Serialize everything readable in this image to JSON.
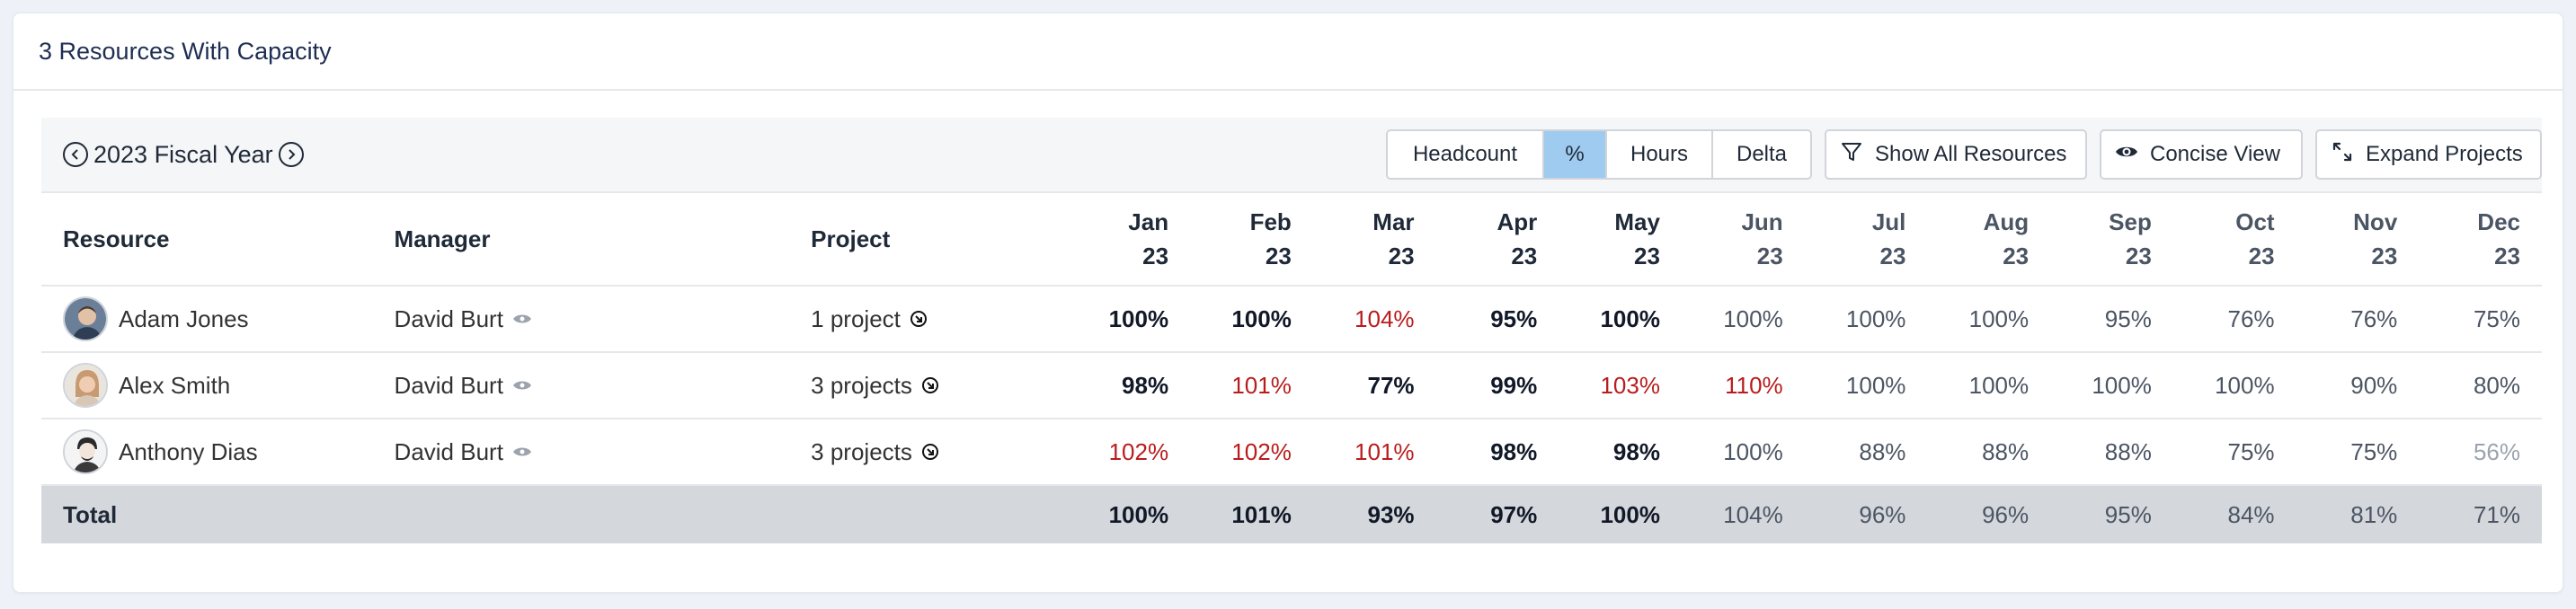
{
  "card": {
    "title": "3 Resources With Capacity"
  },
  "toolbar": {
    "fiscal_year": "2023 Fiscal Year",
    "prev_icon": "chevron-left-circle-icon",
    "next_icon": "chevron-right-circle-icon",
    "view_modes": [
      {
        "label": "Headcount",
        "selected": false
      },
      {
        "label": "%",
        "selected": true
      },
      {
        "label": "Hours",
        "selected": false
      },
      {
        "label": "Delta",
        "selected": false
      }
    ],
    "filter_label": "Show All Resources",
    "view_label": "Concise View",
    "expand_label": "Expand Projects",
    "selected_color": "#9fcbf0"
  },
  "table": {
    "headers": {
      "resource": "Resource",
      "manager": "Manager",
      "project": "Project"
    },
    "months": [
      {
        "m": "Jan",
        "y": "23"
      },
      {
        "m": "Feb",
        "y": "23"
      },
      {
        "m": "Mar",
        "y": "23"
      },
      {
        "m": "Apr",
        "y": "23"
      },
      {
        "m": "May",
        "y": "23"
      },
      {
        "m": "Jun",
        "y": "23"
      },
      {
        "m": "Jul",
        "y": "23"
      },
      {
        "m": "Aug",
        "y": "23"
      },
      {
        "m": "Sep",
        "y": "23"
      },
      {
        "m": "Oct",
        "y": "23"
      },
      {
        "m": "Nov",
        "y": "23"
      },
      {
        "m": "Dec",
        "y": "23"
      }
    ],
    "rows": [
      {
        "name": "Adam Jones",
        "manager": "David Burt",
        "project": "1 project",
        "values": [
          "100%",
          "100%",
          "104%",
          "95%",
          "100%",
          "100%",
          "100%",
          "100%",
          "95%",
          "76%",
          "76%",
          "75%"
        ]
      },
      {
        "name": "Alex Smith",
        "manager": "David Burt",
        "project": "3 projects",
        "values": [
          "98%",
          "101%",
          "77%",
          "99%",
          "103%",
          "110%",
          "100%",
          "100%",
          "100%",
          "100%",
          "90%",
          "80%"
        ]
      },
      {
        "name": "Anthony Dias",
        "manager": "David Burt",
        "project": "3 projects",
        "values": [
          "102%",
          "102%",
          "101%",
          "98%",
          "98%",
          "100%",
          "88%",
          "88%",
          "88%",
          "75%",
          "75%",
          "56%"
        ]
      }
    ],
    "total": {
      "label": "Total",
      "values": [
        "100%",
        "101%",
        "93%",
        "97%",
        "100%",
        "104%",
        "96%",
        "96%",
        "95%",
        "84%",
        "81%",
        "71%"
      ]
    },
    "colors": {
      "over": "#b91c1c",
      "past": "#111827",
      "future": "#4b5563",
      "low": "#9ca3af"
    }
  }
}
